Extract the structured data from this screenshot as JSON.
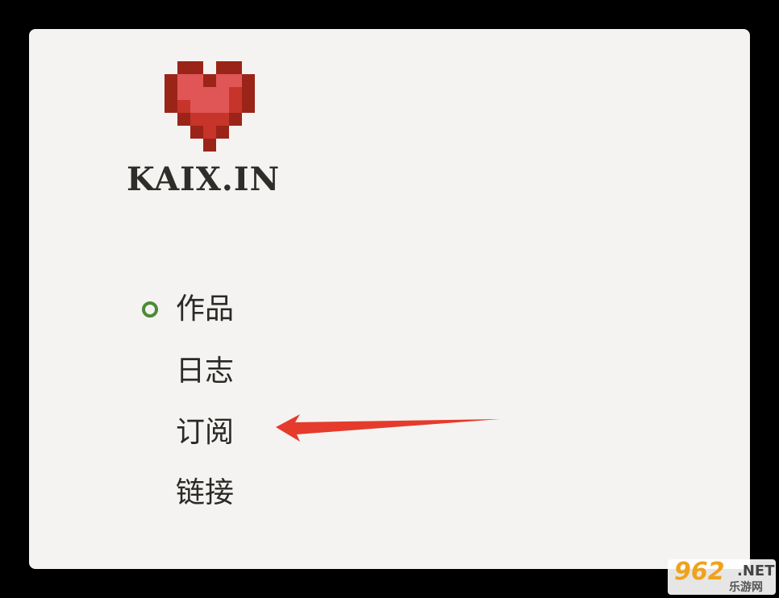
{
  "site": {
    "brand": "KAIX.IN",
    "logo_icon": "pixel-heart-icon",
    "colors": {
      "card_background": "#f5f3f1",
      "active_indicator": "#4d8a35",
      "annotation_arrow": "#e53b2c",
      "heart": "#e05656"
    }
  },
  "nav": {
    "items": [
      {
        "label": "作品",
        "active": true
      },
      {
        "label": "日志",
        "active": false
      },
      {
        "label": "订阅",
        "active": false
      },
      {
        "label": "链接",
        "active": false
      }
    ]
  },
  "annotation": {
    "icon": "red-arrow-icon",
    "points_to": "订阅"
  },
  "watermark": {
    "number": "962",
    "domain": ".NET",
    "subtitle": "乐游网"
  }
}
